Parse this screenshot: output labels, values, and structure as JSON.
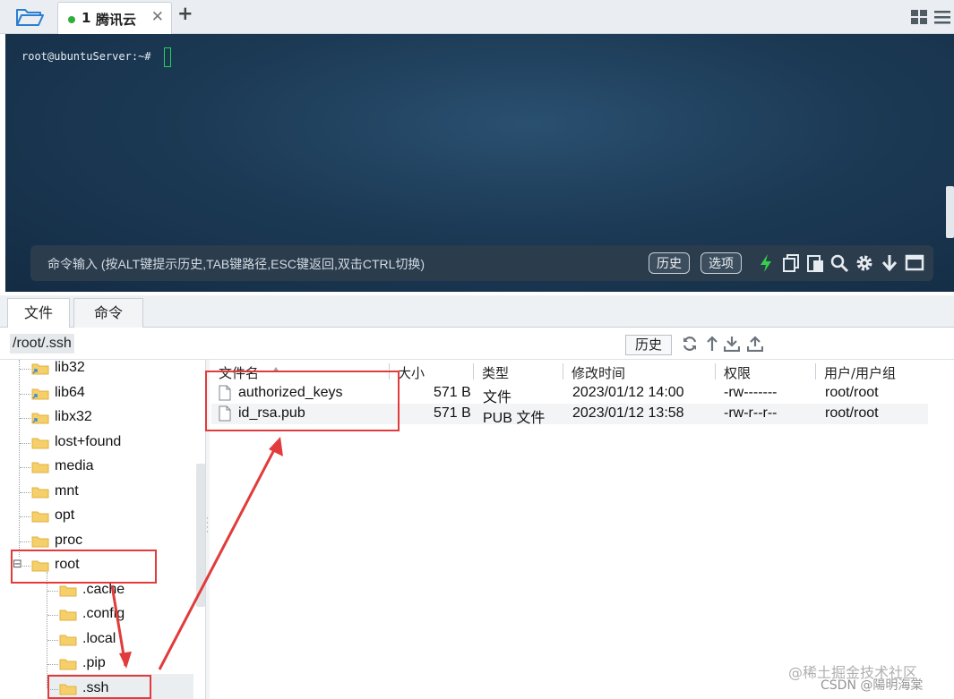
{
  "window": {
    "session_tab": {
      "number": "1",
      "title": "腾讯云",
      "close": "✕",
      "status_color": "#2fae3c"
    },
    "add_tab": "+",
    "icons": [
      "folder-open-icon",
      "grid-view-icon",
      "hamburger-menu-icon"
    ]
  },
  "terminal": {
    "prompt": "root@ubuntuServer:~#",
    "background_color": "#1c3a55",
    "cursor_color": "#28d05a"
  },
  "command_bar": {
    "placeholder": "命令输入 (按ALT键提示历史,TAB键路径,ESC键返回,双击CTRL切换)",
    "history_label": "历史",
    "options_label": "选项",
    "icons": [
      "lightning-icon",
      "copy-icon",
      "paste-icon",
      "search-icon",
      "gear-icon",
      "arrow-down-icon",
      "window-icon"
    ]
  },
  "panel_tabs": {
    "files": "文件",
    "commands": "命令"
  },
  "path_bar": {
    "path": "/root/.ssh",
    "history_label": "历史",
    "icons": [
      "refresh-icon",
      "upload-arrow-icon",
      "download-icon",
      "upload-icon"
    ]
  },
  "tree": {
    "items": [
      {
        "label": "lib32",
        "link": true
      },
      {
        "label": "lib64",
        "link": true
      },
      {
        "label": "libx32",
        "link": true
      },
      {
        "label": "lost+found"
      },
      {
        "label": "media"
      },
      {
        "label": "mnt"
      },
      {
        "label": "opt"
      },
      {
        "label": "proc"
      },
      {
        "label": "root",
        "expanded": true,
        "toggle": "⊟"
      },
      {
        "label": ".cache"
      },
      {
        "label": ".config"
      },
      {
        "label": ".local"
      },
      {
        "label": ".pip"
      },
      {
        "label": ".ssh",
        "selected": true
      }
    ]
  },
  "file_list": {
    "columns": {
      "name": "文件名",
      "size": "大小",
      "type": "类型",
      "modified": "修改时间",
      "permissions": "权限",
      "owner": "用户/用户组"
    },
    "rows": [
      {
        "name": "authorized_keys",
        "size": "571 B",
        "type": "文件",
        "modified": "2023/01/12 14:00",
        "permissions": "-rw-------",
        "owner": "root/root"
      },
      {
        "name": "id_rsa.pub",
        "size": "571 B",
        "type": "PUB 文件",
        "modified": "2023/01/12 13:58",
        "permissions": "-rw-r--r--",
        "owner": "root/root"
      }
    ]
  },
  "annotation_color": "#e23b3b",
  "watermark": {
    "line1": "@稀土掘金技术社区",
    "line2": "CSDN @陽明海棠"
  }
}
